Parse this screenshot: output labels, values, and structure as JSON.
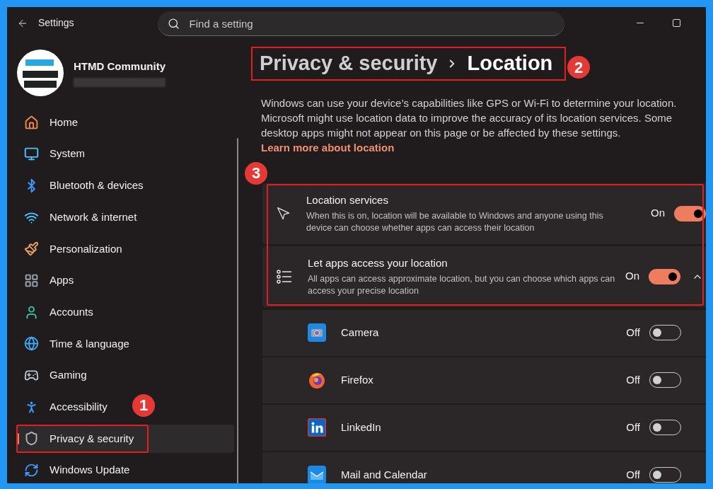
{
  "window": {
    "title": "Settings"
  },
  "search": {
    "placeholder": "Find a setting"
  },
  "profile": {
    "name": "HTMD Community"
  },
  "sidebar": {
    "items": [
      {
        "label": "Home",
        "selected": false
      },
      {
        "label": "System",
        "selected": false
      },
      {
        "label": "Bluetooth & devices",
        "selected": false
      },
      {
        "label": "Network & internet",
        "selected": false
      },
      {
        "label": "Personalization",
        "selected": false
      },
      {
        "label": "Apps",
        "selected": false
      },
      {
        "label": "Accounts",
        "selected": false
      },
      {
        "label": "Time & language",
        "selected": false
      },
      {
        "label": "Gaming",
        "selected": false
      },
      {
        "label": "Accessibility",
        "selected": false
      },
      {
        "label": "Privacy & security",
        "selected": true,
        "callout": "1"
      },
      {
        "label": "Windows Update",
        "selected": false
      }
    ]
  },
  "breadcrumb": {
    "parent": "Privacy & security",
    "current": "Location",
    "callout": "2"
  },
  "description": {
    "text": "Windows can use your device’s capabilities like GPS or Wi-Fi to determine your location. Microsoft might use location data to improve the accuracy of its location services. Some desktop apps might not appear on this page or be affected by these settings.",
    "link": "Learn more about location"
  },
  "location_settings": {
    "callout": "3",
    "items": [
      {
        "title": "Location services",
        "subtitle": "When this is on, location will be available to Windows and anyone using this device can choose whether apps can access their location",
        "state_label": "On",
        "on": true
      },
      {
        "title": "Let apps access your location",
        "subtitle": "All apps can access approximate location, but you can choose which apps can access your precise location",
        "state_label": "On",
        "on": true,
        "expanded": true
      }
    ]
  },
  "apps": [
    {
      "name": "Camera",
      "state_label": "Off",
      "on": false
    },
    {
      "name": "Firefox",
      "state_label": "Off",
      "on": false
    },
    {
      "name": "LinkedIn",
      "state_label": "Off",
      "on": false
    },
    {
      "name": "Mail and Calendar",
      "state_label": "Off",
      "on": false
    }
  ]
}
